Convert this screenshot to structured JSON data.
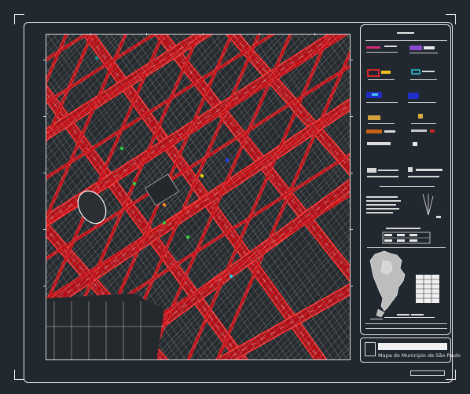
{
  "drawing": {
    "title_block_caption": "Mapa do Municipio de São Paulo"
  },
  "colors": {
    "background": "#212830",
    "frame": "#e6e6e6",
    "road_fill": "#b30f17",
    "road_edge": "#ff2a2a",
    "lot_lines": "#d9d9d9"
  },
  "legend": {
    "items": [
      {
        "icon": "pink-line-symbol"
      },
      {
        "icon": "purple-box-symbol"
      },
      {
        "icon": "red-box-symbol"
      },
      {
        "icon": "cyan-box-symbol"
      },
      {
        "icon": "blue-box-symbol"
      },
      {
        "icon": "tan-box-symbol"
      },
      {
        "icon": "orange-box-symbol"
      }
    ]
  }
}
